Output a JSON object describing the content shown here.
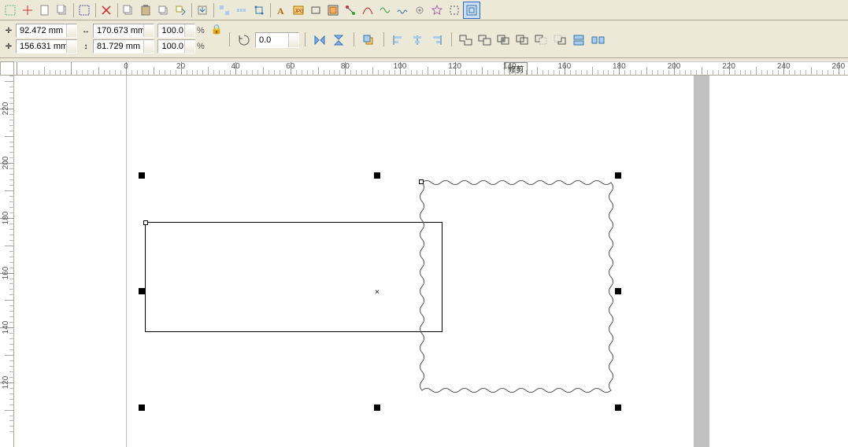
{
  "property_bar": {
    "x_value": "92.472 mm",
    "y_value": "156.631 mm",
    "width_value": "170.673 mm",
    "height_value": "81.729 mm",
    "scale_x": "100.0",
    "scale_y": "100.0",
    "percent_symbol": "%",
    "rotation": "0.0"
  },
  "ruler_h": {
    "labels": [
      "0",
      "20",
      "40",
      "60",
      "80",
      "100",
      "120",
      "140",
      "160",
      "180",
      "200",
      "220",
      "240",
      "260"
    ],
    "tooltip": "修剪"
  },
  "ruler_v": {
    "labels": [
      "220",
      "200",
      "180",
      "160",
      "140",
      "120"
    ]
  }
}
